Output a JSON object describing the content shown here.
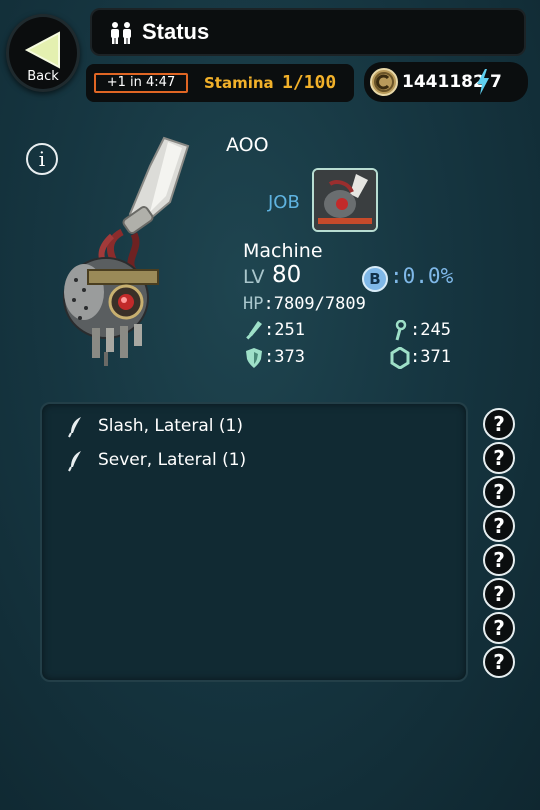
{
  "header": {
    "back_label": "Back",
    "title": "Status"
  },
  "resources": {
    "stamina_timer": "+1 in 4:47",
    "stamina_label": "Stamina",
    "stamina_value": "1/100",
    "coins": "1441182",
    "energy": "7"
  },
  "unit": {
    "name": "AOO",
    "job_label": "JOB",
    "class": "Machine",
    "lv_label": "LV",
    "lv_value": "80",
    "b_icon": "B",
    "b_value": ":0.0%",
    "hp_label": "HP",
    "hp_value": ":7809/7809",
    "stats": {
      "attack": ":251",
      "magic": ":245",
      "defense": ":373",
      "resist": ":371"
    }
  },
  "skills": [
    {
      "label": "Slash, Lateral (1)",
      "icon": "feather-icon"
    },
    {
      "label": "Sever, Lateral (1)",
      "icon": "feather-icon"
    }
  ],
  "help_buttons": [
    "?",
    "?",
    "?",
    "?",
    "?",
    "?",
    "?",
    "?"
  ],
  "info_label": "i",
  "colors": {
    "stamina": "#f2b12a",
    "timer_border": "#e06624",
    "job": "#5fb3e0",
    "panel_bg": "#112a33"
  }
}
